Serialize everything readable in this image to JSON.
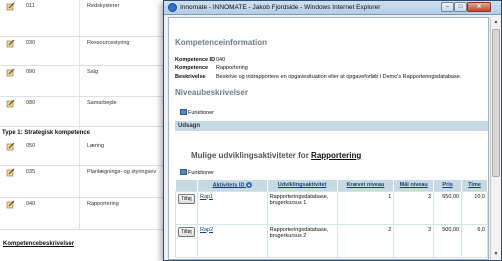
{
  "background": {
    "rows": [
      {
        "code": "011",
        "name": "Redskysterer"
      },
      {
        "code": "030",
        "name": "Ressourcestyring"
      },
      {
        "code": "090",
        "name": "Salg"
      },
      {
        "code": "080",
        "name": "Samarbejde"
      },
      {
        "code": "050",
        "name": "Læring"
      },
      {
        "code": "035",
        "name": "Planlægnings- og styringsev"
      },
      {
        "code": "040",
        "name": "Rapportering"
      }
    ],
    "type_heading": "Type 1: Strategisk kompetence",
    "link_label": "Kompetencebeskrivelser"
  },
  "window": {
    "title": "Innomate - INNOMATE - Jakob Fjordside - Windows Internet Explorer",
    "btn_min": "–",
    "btn_max": "□",
    "btn_close": "✕"
  },
  "info": {
    "section_title": "Kompetenceinformation",
    "id_label": "Kompetence ID",
    "id_value": "040",
    "name_label": "Kompetence",
    "name_value": "Rapportering",
    "desc_label": "Beskrivelse",
    "desc_value": "Beskrive og indrapportere en opgavesituation eller at opgaveforløb i Demo's Rapporteringsdatabase."
  },
  "levels": {
    "section_title": "Niveaubeskrivelser",
    "functions_label": "Funktioner",
    "band_label": "Udsagn"
  },
  "activities": {
    "heading_prefix": "Mulige udviklingsaktiviteter for",
    "heading_link": "Rapportering",
    "functions_label": "Funktioner",
    "columns": [
      "Aktivitets ID",
      "Udviklingsaktivitet",
      "Krævet niveau",
      "Mål niveau",
      "Pris",
      "Time"
    ],
    "rows": [
      {
        "button": "Tilføj",
        "id": "Rap1",
        "activity_1": "Rapporteringsdatabase,",
        "activity_2": "brugerkursus 1",
        "required": "1",
        "goal": "2",
        "price": "650,00",
        "time": "10,0"
      },
      {
        "button": "Tilføj",
        "id": "Rap2",
        "activity_1": "Rapporteringsdatabase,",
        "activity_2": "brugerkursus 2",
        "required": "2",
        "goal": "3",
        "price": "500,00",
        "time": "6,0"
      }
    ]
  },
  "colors": {
    "header_band": "#c6dae3",
    "section_title": "#6d7c88",
    "link": "#1a3e7a"
  }
}
